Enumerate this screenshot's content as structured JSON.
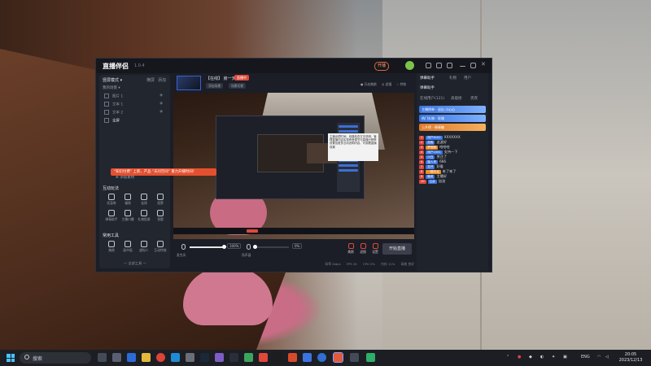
{
  "app": {
    "logo": "直播伴侣",
    "version": "1.0.4",
    "live_badge": "开播",
    "left": {
      "mode_label": "竖屏模式 ▾",
      "tab_scene": "横屏",
      "tab_add": "添加",
      "sources_header": "我的场景 ▾",
      "source_rows": [
        "图片 1",
        "文本 1",
        "文本 2",
        "全屏"
      ],
      "add_source": "⊕ 添加素材",
      "interact_title": "互动玩法",
      "hint": "“知识付费” 上新，产品 “天问空间” 重力开播时间！",
      "interact_tools": [
        "优惠券",
        "福袋",
        "连线",
        "投票",
        "弹幕助手",
        "主播口播",
        "礼物投屏",
        "答题"
      ],
      "common_title": "常用工具",
      "common_tools": [
        "美颜",
        "画中画",
        "虚拟人",
        "互动特效",
        "滤镜",
        "特效",
        "背景音乐",
        "其他"
      ],
      "footer": "— 全部工具 —"
    },
    "scene": {
      "title": "【在线】 房一天",
      "tag": "直播中",
      "btn1": "添加场景",
      "btn2": "场景切换",
      "right1": "● 开启美颜",
      "right2": "◎ 滤镜",
      "right3": "☆ 特效"
    },
    "preview_tip": "主播出镜时间、线路检查文字说明，管理直播内容实现声音调节与直播分辨率设置及更多互动说明内容，可观看直播效果",
    "controls": {
      "mic_label": "麦克风",
      "mic_pct": "100%",
      "mic_level": 1.0,
      "spk_label": "扬声器",
      "spk_pct": "0%",
      "spk_level": 0.0,
      "action1": "美颜",
      "action2": "滤镜",
      "action3": "设置",
      "go_live": "开始直播"
    },
    "status": [
      "码率 0kb/s",
      "FPS 30",
      "CPU 2%",
      "内存 11%",
      "网络 良好"
    ]
  },
  "right_panel": {
    "tab1": "弹幕助手",
    "tab2": "礼物",
    "tab3": "用户",
    "title": "弹幕助手",
    "sub1": "在线用户(121)",
    "sub2": "高能榜",
    "sub3": "贵宾",
    "gifts": [
      "主播榜单 · 送出 小心心",
      "热门礼物 · 玫瑰",
      "上升榜 · 棒棒糖"
    ],
    "messages": [
      {
        "badge": "1",
        "name": "用户6102",
        "text": "XXXXXXX"
      },
      {
        "badge": "2",
        "name": "游客",
        "text": "这波好"
      },
      {
        "badge": "3",
        "name": "梦想家",
        "text": "哈哈哈"
      },
      {
        "badge": "4",
        "name": "用户1031",
        "text": "支持一下"
      },
      {
        "badge": "5",
        "name": "小白",
        "text": "关注了"
      },
      {
        "badge": "6",
        "name": "路人甲",
        "text": "666"
      },
      {
        "badge": "7",
        "name": "花开",
        "text": "好看"
      },
      {
        "badge": "8",
        "name": "一路向北",
        "text": "来了来了"
      },
      {
        "badge": "9",
        "name": "晚风",
        "text": "主播好"
      },
      {
        "badge": "10",
        "name": "云朵",
        "text": "加油"
      }
    ]
  },
  "taskbar": {
    "search_text": "搜索",
    "lang": "ENG",
    "time": "20:05",
    "date": "2023/12/13"
  },
  "colors": {
    "accent": "#e0483a",
    "blue": "#3b74e0",
    "app_bg": "#1b1e26"
  }
}
